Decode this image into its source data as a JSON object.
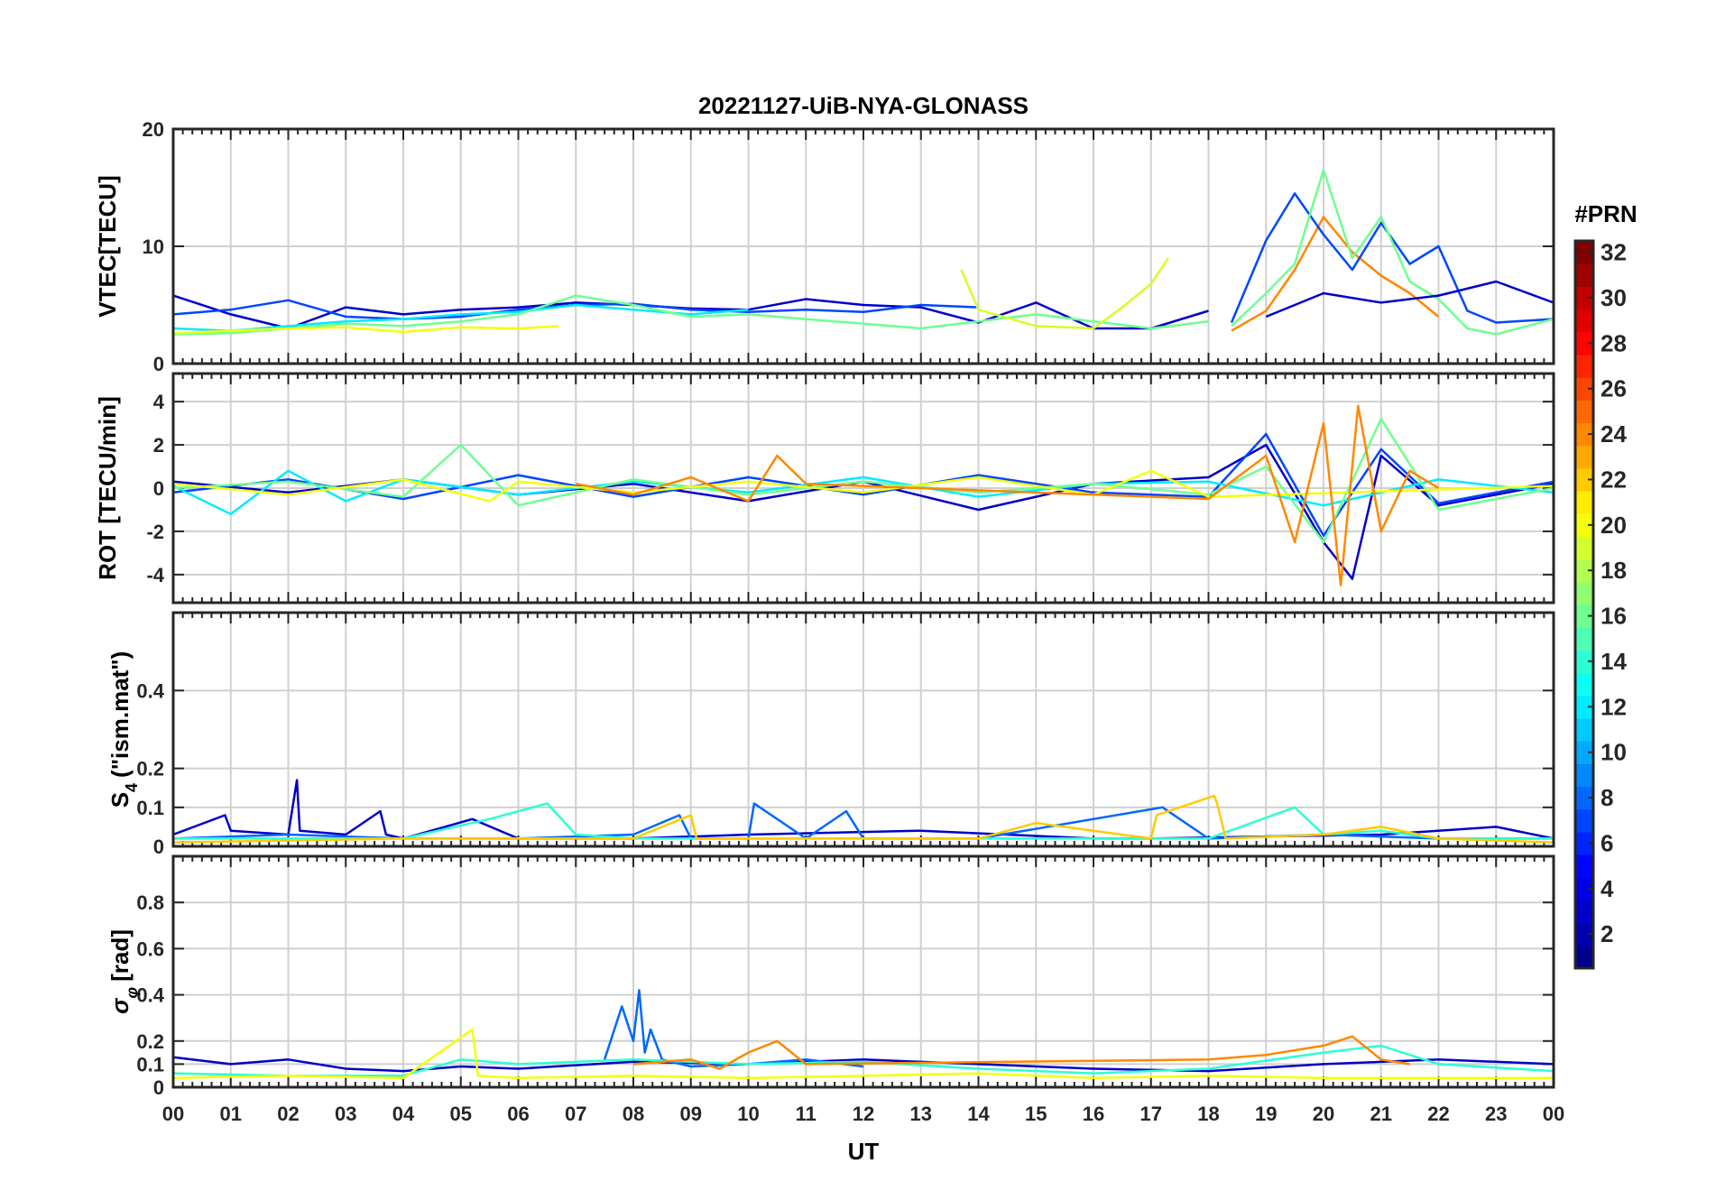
{
  "chart_data": {
    "type": "line",
    "title": "20221127-UiB-NYA-GLONASS",
    "xlabel": "UT",
    "x_range_hours": [
      0,
      24
    ],
    "x_tick_labels": [
      "00",
      "01",
      "02",
      "03",
      "04",
      "05",
      "06",
      "07",
      "08",
      "09",
      "10",
      "11",
      "12",
      "13",
      "14",
      "15",
      "16",
      "17",
      "18",
      "19",
      "20",
      "21",
      "22",
      "23",
      "00"
    ],
    "grid": true,
    "colorbar": {
      "label": "#PRN",
      "range": [
        1,
        32
      ],
      "tick_labels": [
        "2",
        "4",
        "6",
        "8",
        "10",
        "12",
        "14",
        "16",
        "18",
        "20",
        "22",
        "24",
        "26",
        "28",
        "30",
        "32"
      ],
      "colormap": [
        "#00008f",
        "#0000ff",
        "#0080ff",
        "#00ffff",
        "#80ff80",
        "#ffff00",
        "#ff8000",
        "#ff0000",
        "#800000"
      ]
    },
    "panels": [
      {
        "ylabel": "VTEC[TECU]",
        "ylim": [
          0,
          20
        ],
        "y_ticks": [
          0,
          10,
          20
        ],
        "y_tick_labels": [
          "0",
          "10",
          "20"
        ],
        "series": [
          {
            "prn": 3,
            "x": [
              0,
              1,
              2,
              3,
              4,
              5,
              6,
              7,
              8,
              9,
              10,
              11,
              12,
              13,
              14,
              15,
              16,
              17,
              18
            ],
            "y": [
              5.8,
              4.2,
              3.0,
              4.8,
              4.2,
              4.6,
              4.8,
              5.2,
              5.0,
              4.7,
              4.6,
              5.5,
              5.0,
              4.8,
              3.5,
              5.2,
              3.0,
              3.0,
              4.5
            ]
          },
          {
            "prn": 7,
            "x": [
              0,
              1,
              2,
              3,
              4,
              5,
              6,
              7,
              8,
              9,
              10,
              11,
              12,
              13,
              14
            ],
            "y": [
              4.2,
              4.6,
              5.4,
              4.0,
              3.8,
              4.0,
              4.6,
              5.0,
              5.1,
              4.6,
              4.4,
              4.6,
              4.4,
              5.0,
              4.8
            ]
          },
          {
            "prn": 12,
            "x": [
              0,
              1,
              2,
              3,
              4,
              5,
              6,
              7,
              8,
              9,
              10
            ],
            "y": [
              3.0,
              2.8,
              3.2,
              3.6,
              3.8,
              4.2,
              4.4,
              5.0,
              4.6,
              4.2,
              4.6
            ]
          },
          {
            "prn": 16,
            "x": [
              0,
              1,
              2,
              3,
              4,
              5,
              6,
              7,
              8,
              9,
              10,
              11,
              12,
              13,
              14,
              15,
              16,
              17,
              18
            ],
            "y": [
              2.5,
              2.6,
              3.0,
              3.4,
              3.2,
              3.6,
              4.2,
              5.8,
              5.0,
              4.0,
              4.2,
              3.8,
              3.4,
              3.0,
              3.6,
              4.2,
              3.6,
              3.0,
              3.6
            ]
          },
          {
            "prn": 20,
            "x": [
              0,
              1,
              2,
              3,
              4,
              5,
              6,
              6.7
            ],
            "y": [
              2.6,
              2.8,
              3.0,
              3.1,
              2.7,
              3.1,
              3.0,
              3.2
            ]
          },
          {
            "prn": 19,
            "x": [
              13.7,
              14,
              15,
              16,
              16.5,
              17,
              17.3
            ],
            "y": [
              8.0,
              4.6,
              3.2,
              3.0,
              4.8,
              6.8,
              9.0
            ]
          },
          {
            "prn": 24,
            "x": [
              18.4,
              19,
              19.5,
              20,
              20.5,
              21,
              21.5,
              22
            ],
            "y": [
              2.8,
              4.5,
              8.0,
              12.5,
              9.5,
              7.5,
              6.0,
              4.0
            ]
          },
          {
            "prn": 7,
            "x": [
              18.4,
              19,
              19.5,
              20,
              20.5,
              21,
              21.5,
              22,
              22.5,
              23,
              24
            ],
            "y": [
              3.5,
              10.5,
              14.5,
              11.0,
              8.0,
              12.0,
              8.5,
              10.0,
              4.5,
              3.5,
              3.8
            ]
          },
          {
            "prn": 16,
            "x": [
              18.4,
              19,
              19.5,
              20,
              20.5,
              21,
              21.5,
              22,
              22.5,
              23,
              24
            ],
            "y": [
              3.2,
              6.0,
              8.5,
              16.5,
              9.0,
              12.5,
              7.0,
              5.5,
              3.0,
              2.5,
              3.8
            ]
          },
          {
            "prn": 3,
            "x": [
              19,
              20,
              21,
              22,
              23,
              24
            ],
            "y": [
              4.0,
              6.0,
              5.2,
              5.8,
              7.0,
              5.2
            ]
          }
        ]
      },
      {
        "ylabel": "ROT [TECU/min]",
        "ylim": [
          -5.3,
          5.3
        ],
        "y_ticks": [
          -4,
          -2,
          0,
          2,
          4
        ],
        "y_tick_labels": [
          "-4",
          "-2",
          "0",
          "2",
          "4"
        ],
        "series": [
          {
            "prn": 3,
            "x": [
              0,
              2,
              4,
              6,
              8,
              10,
              12,
              14,
              16,
              18,
              19,
              20,
              20.5,
              21,
              22,
              24
            ],
            "y": [
              0.3,
              -0.2,
              0.4,
              -0.3,
              0.2,
              -0.6,
              0.3,
              -1.0,
              0.2,
              0.5,
              2.0,
              -2.5,
              -4.2,
              1.5,
              -0.8,
              0.2
            ]
          },
          {
            "prn": 7,
            "x": [
              0,
              2,
              4,
              6,
              8,
              10,
              12,
              14,
              16,
              18,
              19,
              20,
              21,
              22,
              24
            ],
            "y": [
              -0.2,
              0.4,
              -0.5,
              0.6,
              -0.4,
              0.5,
              -0.3,
              0.6,
              -0.2,
              -0.4,
              2.5,
              -2.2,
              1.8,
              -0.7,
              0.3
            ]
          },
          {
            "prn": 12,
            "x": [
              0,
              1,
              2,
              3,
              4,
              6,
              8,
              10,
              12,
              14,
              16,
              18,
              20,
              22,
              24
            ],
            "y": [
              0.1,
              -1.2,
              0.8,
              -0.6,
              0.4,
              -0.3,
              0.3,
              -0.2,
              0.5,
              -0.4,
              0.2,
              0.3,
              -0.8,
              0.4,
              -0.2
            ]
          },
          {
            "prn": 16,
            "x": [
              0,
              2,
              4,
              5,
              6,
              8,
              10,
              12,
              14,
              16,
              18,
              19,
              20,
              21,
              22,
              24
            ],
            "y": [
              0.0,
              0.3,
              -0.4,
              2.0,
              -0.8,
              0.4,
              -0.3,
              0.3,
              -0.2,
              0.2,
              -0.3,
              1.0,
              -2.5,
              3.2,
              -1.0,
              0.0
            ]
          },
          {
            "prn": 20,
            "x": [
              0,
              2,
              4,
              5.5,
              6,
              8,
              10,
              12,
              14,
              16,
              17,
              18,
              24
            ],
            "y": [
              0.2,
              -0.3,
              0.4,
              -0.6,
              0.3,
              -0.2,
              0.3,
              -0.2,
              0.5,
              -0.3,
              0.8,
              -0.4,
              0.1
            ]
          },
          {
            "prn": 24,
            "x": [
              7,
              8,
              9,
              10,
              10.5,
              11,
              18,
              19,
              19.5,
              20,
              20.3,
              20.6,
              21,
              21.5,
              22
            ],
            "y": [
              0.2,
              -0.3,
              0.5,
              -0.6,
              1.5,
              0.2,
              -0.5,
              1.5,
              -2.5,
              3.0,
              -4.5,
              3.8,
              -2.0,
              0.8,
              0.0
            ]
          }
        ]
      },
      {
        "ylabel_main": "S",
        "ylabel_sub": "4",
        "ylabel_rest": "(\"ism.mat\")",
        "ylim": [
          0,
          0.6
        ],
        "y_ticks": [
          0,
          0.1,
          0.2,
          0.4
        ],
        "y_tick_labels": [
          "0",
          "0.1",
          "0.2",
          "0.4"
        ],
        "series": [
          {
            "prn": 3,
            "x": [
              0,
              0.9,
              1.0,
              2.0,
              2.15,
              2.2,
              3.0,
              3.6,
              3.7,
              4.0,
              5.2,
              6.0,
              8.0,
              10.0,
              13.0,
              16.0,
              17.0,
              21.0,
              23.0,
              24.0
            ],
            "y": [
              0.03,
              0.08,
              0.04,
              0.03,
              0.17,
              0.04,
              0.03,
              0.09,
              0.03,
              0.02,
              0.07,
              0.02,
              0.02,
              0.03,
              0.04,
              0.02,
              0.02,
              0.03,
              0.05,
              0.02
            ]
          },
          {
            "prn": 8,
            "x": [
              0,
              2,
              4,
              6,
              8,
              8.8,
              9,
              10,
              10.1,
              11,
              11.7,
              12,
              14,
              17.2,
              18,
              20,
              22,
              24
            ],
            "y": [
              0.02,
              0.03,
              0.02,
              0.02,
              0.03,
              0.08,
              0.02,
              0.02,
              0.11,
              0.02,
              0.09,
              0.02,
              0.02,
              0.1,
              0.02,
              0.03,
              0.02,
              0.02
            ]
          },
          {
            "prn": 14,
            "x": [
              0,
              2,
              4,
              5.5,
              6.5,
              7,
              8,
              10,
              12,
              14,
              16,
              18,
              19.5,
              20,
              21,
              22,
              24
            ],
            "y": [
              0.02,
              0.02,
              0.02,
              0.07,
              0.11,
              0.03,
              0.02,
              0.02,
              0.02,
              0.02,
              0.02,
              0.02,
              0.1,
              0.03,
              0.04,
              0.02,
              0.02
            ]
          },
          {
            "prn": 22,
            "x": [
              0,
              4,
              8,
              9.0,
              9.1,
              10,
              14,
              15,
              17,
              17.1,
              18.1,
              18.15,
              18.3,
              20,
              21,
              22,
              24
            ],
            "y": [
              0.01,
              0.02,
              0.02,
              0.08,
              0.02,
              0.02,
              0.02,
              0.06,
              0.02,
              0.08,
              0.13,
              0.11,
              0.02,
              0.03,
              0.05,
              0.02,
              0.01
            ]
          }
        ]
      },
      {
        "ylabel_main": "σ",
        "ylabel_sub": "φ",
        "ylabel_rest": "[rad]",
        "ylim": [
          0,
          1.0
        ],
        "y_ticks": [
          0,
          0.1,
          0.2,
          0.4,
          0.6,
          0.8
        ],
        "y_tick_labels": [
          "0",
          "0.1",
          "0.2",
          "0.4",
          "0.6",
          "0.8"
        ],
        "series": [
          {
            "prn": 3,
            "x": [
              0,
              1,
              2,
              3,
              4,
              5,
              6,
              8,
              10,
              12,
              14,
              16,
              18,
              20,
              22,
              24
            ],
            "y": [
              0.13,
              0.1,
              0.12,
              0.08,
              0.07,
              0.09,
              0.08,
              0.11,
              0.1,
              0.12,
              0.1,
              0.08,
              0.07,
              0.1,
              0.12,
              0.1
            ]
          },
          {
            "prn": 8,
            "x": [
              7.5,
              7.8,
              8.0,
              8.1,
              8.2,
              8.3,
              8.5,
              9,
              10,
              11,
              12
            ],
            "y": [
              0.12,
              0.35,
              0.2,
              0.42,
              0.15,
              0.25,
              0.12,
              0.09,
              0.1,
              0.12,
              0.09
            ]
          },
          {
            "prn": 14,
            "x": [
              0,
              2,
              4,
              5,
              6,
              8,
              10,
              12,
              14,
              16,
              18,
              20,
              21,
              22,
              24
            ],
            "y": [
              0.06,
              0.05,
              0.05,
              0.12,
              0.1,
              0.12,
              0.1,
              0.11,
              0.08,
              0.06,
              0.08,
              0.15,
              0.18,
              0.1,
              0.07
            ]
          },
          {
            "prn": 20,
            "x": [
              0,
              2,
              4,
              5.2,
              5.3,
              6,
              8,
              10,
              12,
              14,
              16,
              18,
              20,
              22,
              24
            ],
            "y": [
              0.04,
              0.05,
              0.04,
              0.25,
              0.05,
              0.04,
              0.05,
              0.04,
              0.05,
              0.06,
              0.04,
              0.05,
              0.04,
              0.04,
              0.04
            ]
          },
          {
            "prn": 24,
            "x": [
              8,
              9,
              9.5,
              10,
              10.5,
              11,
              18,
              19,
              20,
              20.5,
              21,
              21.5
            ],
            "y": [
              0.1,
              0.12,
              0.08,
              0.15,
              0.2,
              0.1,
              0.12,
              0.14,
              0.18,
              0.22,
              0.12,
              0.1
            ]
          }
        ]
      }
    ]
  }
}
